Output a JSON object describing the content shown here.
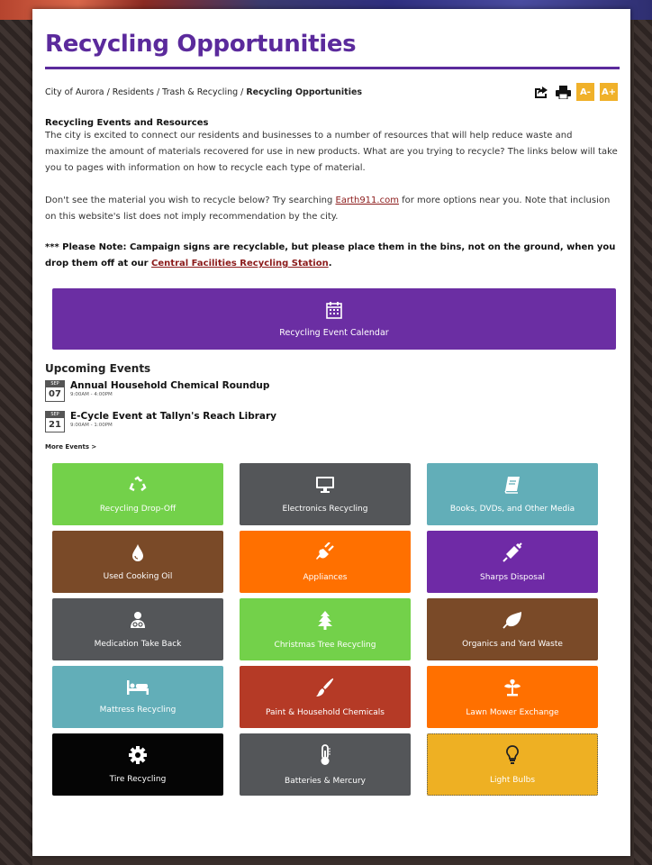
{
  "page": {
    "title": "Recycling Opportunities"
  },
  "breadcrumb": [
    "City of Aurora",
    "Residents",
    "Trash & Recycling",
    "Recycling Opportunities"
  ],
  "tools": {
    "font_smaller": "A-",
    "font_larger": "A+"
  },
  "intro": {
    "heading": "Recycling Events and Resources",
    "body": "The city is excited to connect our residents and businesses to a number of resources that will help reduce waste and maximize the amount of materials recovered for use in new products. What are you trying to recycle? The links below will take you to pages with information on how to recycle each type of material.",
    "search_prefix": "Don't see the material you wish to recycle below? Try searching ",
    "search_link": "Earth911.com",
    "search_suffix": " for more options near you. Note that inclusion on this website's list does not imply recommendation by the city."
  },
  "note": {
    "prefix": "*** Please Note: Campaign signs are recyclable, but please place them in the bins, not on the ground, when you drop them off at our ",
    "link": "Central Facilities Recycling Station",
    "suffix": "."
  },
  "calendar_button": {
    "label": "Recycling Event Calendar",
    "icon": "calendar-icon"
  },
  "events": {
    "heading": "Upcoming Events",
    "items": [
      {
        "month": "SEP",
        "day": "07",
        "title": "Annual Household Chemical Roundup",
        "time": "9:00AM - 4:00PM"
      },
      {
        "month": "SEP",
        "day": "21",
        "title": "E-Cycle Event at Tallyn's Reach Library",
        "time": "9:00AM - 1:00PM"
      }
    ],
    "more": "More Events >"
  },
  "tiles": [
    {
      "label": "Recycling Drop-Off",
      "icon": "recycle-icon",
      "color": "#73d14a"
    },
    {
      "label": "Electronics Recycling",
      "icon": "monitor-icon",
      "color": "#545659"
    },
    {
      "label": "Books, DVDs, and Other Media",
      "icon": "book-icon",
      "color": "#62aeb8"
    },
    {
      "label": "Used Cooking Oil",
      "icon": "oil-drop-icon",
      "color": "#7a4a28"
    },
    {
      "label": "Appliances",
      "icon": "plug-icon",
      "color": "#ff7000"
    },
    {
      "label": "Sharps Disposal",
      "icon": "syringe-icon",
      "color": "#6f2aa6"
    },
    {
      "label": "Medication Take Back",
      "icon": "doctor-icon",
      "color": "#545659"
    },
    {
      "label": "Christmas Tree Recycling",
      "icon": "tree-icon",
      "color": "#73d14a"
    },
    {
      "label": "Organics and Yard Waste",
      "icon": "leaf-icon",
      "color": "#7a4a28"
    },
    {
      "label": "Mattress Recycling",
      "icon": "bed-icon",
      "color": "#62aeb8"
    },
    {
      "label": "Paint & Household Chemicals",
      "icon": "paintbrush-icon",
      "color": "#b53a26"
    },
    {
      "label": "Lawn Mower Exchange",
      "icon": "plant-icon",
      "color": "#ff7000"
    },
    {
      "label": "Tire Recycling",
      "icon": "gear-icon",
      "color": "#050505"
    },
    {
      "label": "Batteries & Mercury",
      "icon": "thermometer-icon",
      "color": "#545659"
    },
    {
      "label": "Light Bulbs",
      "icon": "lightbulb-icon",
      "color": "#eeb023"
    }
  ]
}
